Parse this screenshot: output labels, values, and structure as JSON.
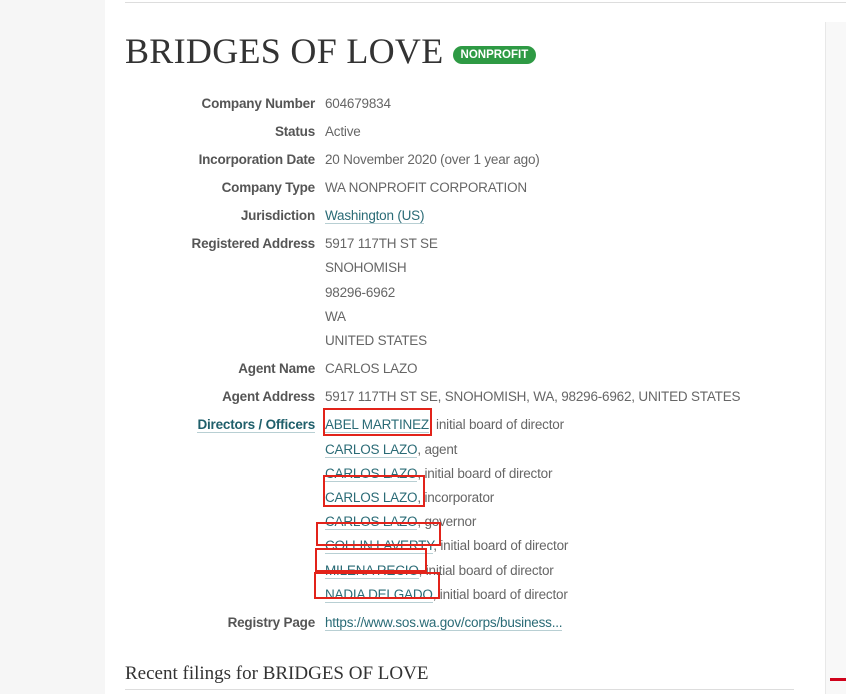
{
  "company": {
    "name": "BRIDGES OF LOVE",
    "badge": "NONPROFIT",
    "badge_color": "#2e9a44"
  },
  "attributes": {
    "company_number": {
      "label": "Company Number",
      "value": "604679834"
    },
    "status": {
      "label": "Status",
      "value": "Active"
    },
    "incorporation_date": {
      "label": "Incorporation Date",
      "value": "20 November 2020 (over 1 year ago)"
    },
    "company_type": {
      "label": "Company Type",
      "value": "WA NONPROFIT CORPORATION"
    },
    "jurisdiction": {
      "label": "Jurisdiction",
      "value": "Washington (US)"
    },
    "registered_address": {
      "label": "Registered Address",
      "lines": [
        "5917 117TH ST SE",
        "SNOHOMISH",
        "98296-6962",
        "WA",
        "UNITED STATES"
      ]
    },
    "agent_name": {
      "label": "Agent Name",
      "value": "CARLOS LAZO"
    },
    "agent_address": {
      "label": "Agent Address",
      "value": "5917 117TH ST SE, SNOHOMISH, WA, 98296-6962, UNITED STATES"
    },
    "directors": {
      "label": "Directors / Officers",
      "items": [
        {
          "name": "ABEL MARTINEZ",
          "role": "initial board of director",
          "highlighted": true
        },
        {
          "name": "CARLOS LAZO",
          "role": "agent",
          "highlighted": false
        },
        {
          "name": "CARLOS LAZO",
          "role": "initial board of director",
          "highlighted": false
        },
        {
          "name": "CARLOS LAZO",
          "role": "incorporator",
          "highlighted": true
        },
        {
          "name": "CARLOS LAZO",
          "role": "governor",
          "highlighted": false
        },
        {
          "name": "COLLIN LAVERTY",
          "role": "initial board of director",
          "highlighted": true
        },
        {
          "name": "MILENA RECIO",
          "role": "initial board of director",
          "highlighted": true
        },
        {
          "name": "NADIA DELGADO",
          "role": "initial board of director",
          "highlighted": true
        }
      ]
    },
    "registry_page": {
      "label": "Registry Page",
      "value": "https://www.sos.wa.gov/corps/business..."
    }
  },
  "recent_filings": {
    "title": "Recent filings for BRIDGES OF LOVE"
  },
  "highlight_color": "#e2231a"
}
